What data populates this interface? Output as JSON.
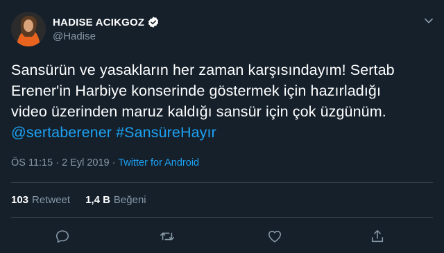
{
  "user": {
    "display_name": "HADISE ACIKGOZ",
    "handle": "@Hadise",
    "avatar_icon": "user-avatar"
  },
  "tweet": {
    "text_line1": "Sansürün ve yasakların her zaman karşısındayım! Sertab",
    "text_line2": "Erener'in Harbiye konserinde göstermek için hazırladığı",
    "text_line3": "video üzerinden maruz kaldığı sansür için çok üzgünüm.",
    "mention": "@sertaberener",
    "hashtag": "#SansüreHayır",
    "time": "ÖS 11:15",
    "separator": " · ",
    "date": "2 Eyl 2019",
    "source": "Twitter for Android"
  },
  "stats": {
    "retweets": "103",
    "retweets_label": "Retweet",
    "likes": "1,4 B",
    "likes_label": "Beğeni"
  },
  "actions": {
    "reply_icon": "reply-icon",
    "retweet_icon": "retweet-icon",
    "like_icon": "like-icon",
    "share_icon": "share-icon"
  },
  "colors": {
    "background": "#15202b",
    "link": "#1da1f2",
    "secondary": "#8899a6",
    "divider": "#38444d"
  }
}
